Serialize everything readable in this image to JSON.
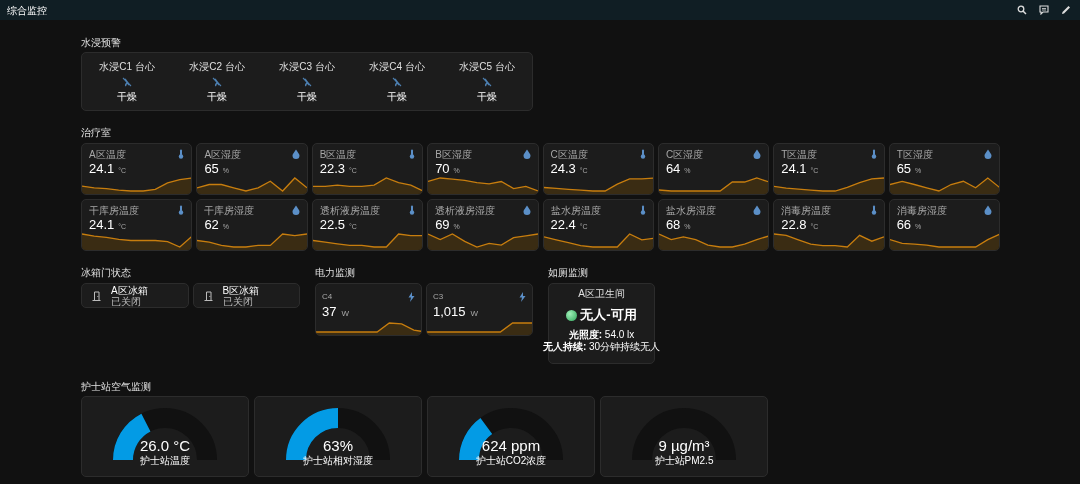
{
  "header": {
    "title": "综合监控"
  },
  "water": {
    "title": "水浸预警",
    "items": [
      {
        "name": "水浸C1 台心",
        "status": "干燥"
      },
      {
        "name": "水浸C2 台心",
        "status": "干燥"
      },
      {
        "name": "水浸C3 台心",
        "status": "干燥"
      },
      {
        "name": "水浸C4 台心",
        "status": "干燥"
      },
      {
        "name": "水浸C5 台心",
        "status": "干燥"
      }
    ]
  },
  "treatment": {
    "title": "治疗室",
    "sensors": [
      {
        "kind": "temperature",
        "name": "A区温度",
        "value": "24.1",
        "unit": "°C"
      },
      {
        "kind": "humidity",
        "name": "A区湿度",
        "value": "65",
        "unit": "%"
      },
      {
        "kind": "temperature",
        "name": "B区温度",
        "value": "22.3",
        "unit": "°C"
      },
      {
        "kind": "humidity",
        "name": "B区湿度",
        "value": "70",
        "unit": "%"
      },
      {
        "kind": "temperature",
        "name": "C区温度",
        "value": "24.3",
        "unit": "°C"
      },
      {
        "kind": "humidity",
        "name": "C区湿度",
        "value": "64",
        "unit": "%"
      },
      {
        "kind": "temperature",
        "name": "T区温度",
        "value": "24.1",
        "unit": "°C"
      },
      {
        "kind": "humidity",
        "name": "T区湿度",
        "value": "65",
        "unit": "%"
      },
      {
        "kind": "temperature",
        "name": "干库房温度",
        "value": "24.1",
        "unit": "°C"
      },
      {
        "kind": "humidity",
        "name": "干库房湿度",
        "value": "62",
        "unit": "%"
      },
      {
        "kind": "temperature",
        "name": "透析液房温度",
        "value": "22.5",
        "unit": "°C"
      },
      {
        "kind": "humidity",
        "name": "透析液房湿度",
        "value": "69",
        "unit": "%"
      },
      {
        "kind": "temperature",
        "name": "盐水房温度",
        "value": "22.4",
        "unit": "°C"
      },
      {
        "kind": "humidity",
        "name": "盐水房湿度",
        "value": "68",
        "unit": "%"
      },
      {
        "kind": "temperature",
        "name": "消毒房温度",
        "value": "22.8",
        "unit": "°C"
      },
      {
        "kind": "humidity",
        "name": "消毒房湿度",
        "value": "66",
        "unit": "%"
      }
    ]
  },
  "fridge": {
    "title": "冰箱门状态",
    "doors": [
      {
        "name": "A区冰箱",
        "state": "已关闭"
      },
      {
        "name": "B区冰箱",
        "state": "已关闭"
      }
    ]
  },
  "power": {
    "title": "电力监测",
    "meters": [
      {
        "name": "C4",
        "value": "37",
        "unit": "W"
      },
      {
        "name": "C3",
        "value": "1,015",
        "unit": "W"
      }
    ]
  },
  "toilet": {
    "title": "如厕监测",
    "room": "A区卫生间",
    "status": "无人-可用",
    "details": [
      "**光照度:** 54.0 lx",
      "**无人持续:** 30分钟持续无人"
    ]
  },
  "air": {
    "title": "护士站空气监测",
    "gauges": [
      {
        "value": "26.0 °C",
        "name": "护士站温度"
      },
      {
        "value": "63%",
        "name": "护士站相对湿度"
      },
      {
        "value": "624 ppm",
        "name": "护士站CO2浓度"
      },
      {
        "value": "9 µg/m³",
        "name": "护士站PM2.5"
      }
    ]
  }
}
